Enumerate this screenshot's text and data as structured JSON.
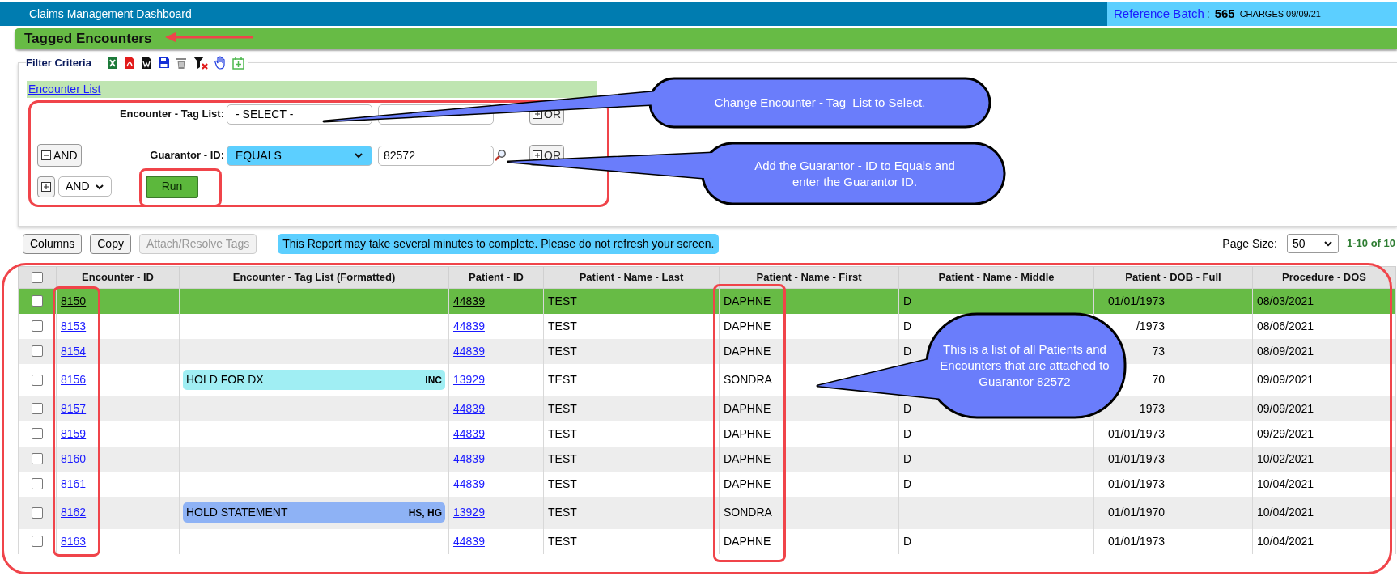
{
  "top_bar": {
    "title": "Claims Management Dashboard",
    "reference_label": "Reference Batch",
    "separator": ":",
    "batch_number": "565",
    "batch_info": "CHARGES 09/09/21"
  },
  "page_title": "Tagged Encounters",
  "filter": {
    "legend": "Filter Criteria",
    "list_name": "Encounter List",
    "conditions": [
      {
        "kind": "field",
        "label": "Encounter - Tag List:",
        "operator": "- SELECT -",
        "focused": false,
        "or_label": "OR"
      },
      {
        "kind": "field",
        "join": "AND",
        "label": "Guarantor - ID:",
        "operator": "EQUALS",
        "focused": true,
        "value": "82572",
        "or_label": "OR"
      }
    ],
    "join_select": "AND",
    "run_label": "Run"
  },
  "actions": [
    {
      "label": "Columns",
      "disabled": false
    },
    {
      "label": "Copy",
      "disabled": false
    },
    {
      "label": "Attach/Resolve Tags",
      "disabled": true
    }
  ],
  "notice": "This Report may take several minutes to complete. Please do not refresh your screen.",
  "page_size": {
    "label": "Page Size:",
    "value": "50",
    "range": "1-10 of 10"
  },
  "table": {
    "select_all": {
      "checked": false
    },
    "columns": [
      "Encounter - ID",
      "Encounter - Tag List (Formatted)",
      "Patient - ID",
      "Patient - Name - Last",
      "Patient - Name - First",
      "Patient - Name - Middle",
      "Patient - DOB - Full",
      "Procedure - DOS"
    ],
    "rows": [
      {
        "selected": true,
        "checked": false,
        "encounter_id": "8150",
        "patient_id": "44839",
        "last": "TEST",
        "first": "DAPHNE",
        "middle": "D",
        "dob": "01/01/1973",
        "dos": "08/03/2021"
      },
      {
        "selected": false,
        "checked": false,
        "encounter_id": "8153",
        "patient_id": "44839",
        "last": "TEST",
        "first": "DAPHNE",
        "middle": "D",
        "dob": "/1973",
        "dos": "08/06/2021"
      },
      {
        "selected": false,
        "checked": false,
        "encounter_id": "8154",
        "patient_id": "44839",
        "last": "TEST",
        "first": "DAPHNE",
        "middle": "D",
        "dob": "73",
        "dos": "08/09/2021"
      },
      {
        "selected": false,
        "checked": false,
        "encounter_id": "8156",
        "tag": {
          "label": "HOLD FOR DX",
          "code": "INC",
          "color": "#a0eef3"
        },
        "patient_id": "13929",
        "last": "TEST",
        "first": "SONDRA",
        "dob": "70",
        "dos": "09/09/2021"
      },
      {
        "selected": false,
        "checked": false,
        "encounter_id": "8157",
        "patient_id": "44839",
        "last": "TEST",
        "first": "DAPHNE",
        "middle": "D",
        "dob": "1973",
        "dos": "09/09/2021"
      },
      {
        "selected": false,
        "checked": false,
        "encounter_id": "8159",
        "patient_id": "44839",
        "last": "TEST",
        "first": "DAPHNE",
        "middle": "D",
        "dob": "01/01/1973",
        "dos": "09/29/2021"
      },
      {
        "selected": false,
        "checked": false,
        "encounter_id": "8160",
        "patient_id": "44839",
        "last": "TEST",
        "first": "DAPHNE",
        "middle": "D",
        "dob": "01/01/1973",
        "dos": "10/02/2021"
      },
      {
        "selected": false,
        "checked": false,
        "encounter_id": "8161",
        "patient_id": "44839",
        "last": "TEST",
        "first": "DAPHNE",
        "middle": "D",
        "dob": "01/01/1973",
        "dos": "10/04/2021"
      },
      {
        "selected": false,
        "checked": false,
        "encounter_id": "8162",
        "tag": {
          "label": "HOLD STATEMENT",
          "code": "HS, HG",
          "color": "#8eb2f5"
        },
        "patient_id": "13929",
        "last": "TEST",
        "first": "SONDRA",
        "dob": "01/01/1970",
        "dos": "10/04/2021"
      },
      {
        "selected": false,
        "checked": false,
        "encounter_id": "8163",
        "patient_id": "44839",
        "last": "TEST",
        "first": "DAPHNE",
        "middle": "D",
        "dob": "01/01/1973",
        "dos": "10/04/2021"
      }
    ]
  },
  "annotations": [
    {
      "text": "Change Encounter - Tag  List to Select."
    },
    {
      "text": "Add the Guarantor - ID to Equals and enter the Guarantor ID."
    },
    {
      "text": "This is a list of all Patients and Encounters that are attached to Guarantor 82572"
    }
  ]
}
